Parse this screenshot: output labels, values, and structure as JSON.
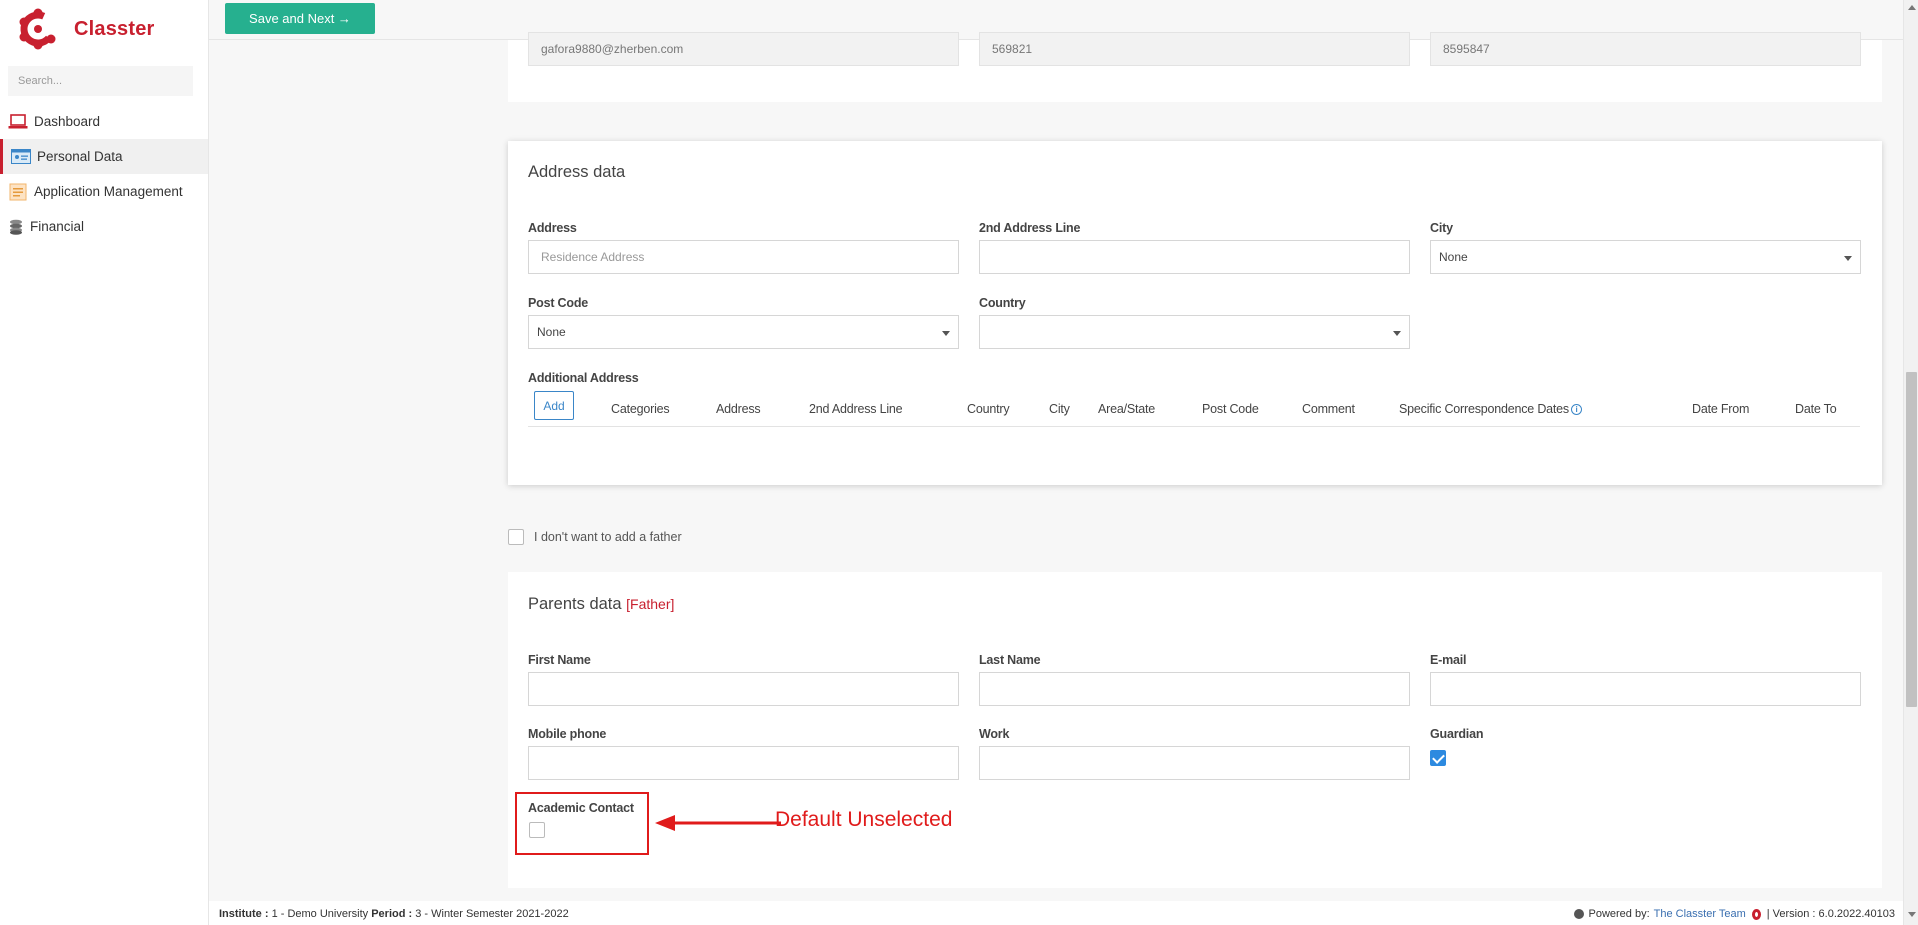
{
  "app": {
    "name": "Classter",
    "brand_color": "#c8202f"
  },
  "sidebar": {
    "search_placeholder": "Search...",
    "items": [
      {
        "label": "Dashboard",
        "icon": "laptop-icon",
        "active": false
      },
      {
        "label": "Personal Data",
        "icon": "id-card-icon",
        "active": true
      },
      {
        "label": "Application Management",
        "icon": "document-icon",
        "active": false
      },
      {
        "label": "Financial",
        "icon": "coins-icon",
        "active": false
      }
    ]
  },
  "toolbar": {
    "save_label": "Save and Next →",
    "save_color": "#26b08f"
  },
  "contact_row": {
    "email": "gafora9880@zherben.com",
    "phone1": "569821",
    "phone2": "8595847"
  },
  "address": {
    "title": "Address data",
    "fields": {
      "address_label": "Address",
      "address_placeholder": "Residence Address",
      "line2_label": "2nd Address Line",
      "city_label": "City",
      "city_value": "None",
      "postcode_label": "Post Code",
      "postcode_value": "None",
      "country_label": "Country",
      "country_value": ""
    },
    "additional": {
      "label": "Additional Address",
      "add_label": "Add",
      "columns": [
        "Categories",
        "Address",
        "2nd Address Line",
        "Country",
        "City",
        "Area/State",
        "Post Code",
        "Comment",
        "Specific Correspondence Dates",
        "Date From",
        "Date To"
      ]
    }
  },
  "no_father": {
    "label": "I don't want to add a father",
    "checked": false
  },
  "parents": {
    "title": "Parents data",
    "tag": "[Father]",
    "first_name_label": "First Name",
    "last_name_label": "Last Name",
    "email_label": "E-mail",
    "mobile_label": "Mobile phone",
    "work_label": "Work",
    "guardian_label": "Guardian",
    "guardian_checked": true,
    "academic_label": "Academic Contact",
    "academic_checked": false
  },
  "annotation": {
    "text": "Default Unselected",
    "color": "#e01b1b"
  },
  "footer": {
    "institute_label": "Institute :",
    "institute_value": "1 - Demo University",
    "period_label": "Period :",
    "period_value": "3 - Winter Semester 2021-2022",
    "powered_label": "Powered by:",
    "powered_value": "The Classter Team",
    "version_label": "| Version : 6.0.2022.40103"
  }
}
